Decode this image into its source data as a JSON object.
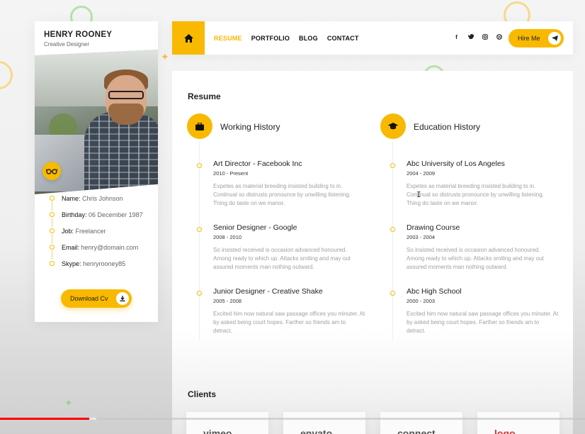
{
  "profile": {
    "name": "HENRY ROONEY",
    "role": "Creative Designer",
    "info": [
      {
        "label": "Name:",
        "value": "Chris Johnson"
      },
      {
        "label": "Birthday:",
        "value": "06 December 1987"
      },
      {
        "label": "Job:",
        "value": "Freelancer"
      },
      {
        "label": "Email:",
        "value": "henry@domain.com"
      },
      {
        "label": "Skype:",
        "value": "henryrooney85"
      }
    ],
    "download_label": "Download Cv"
  },
  "nav": {
    "items": [
      "RESUME",
      "PORTFOLIO",
      "BLOG",
      "CONTACT"
    ],
    "active": "RESUME",
    "socials": [
      "facebook-icon",
      "twitter-icon",
      "instagram-icon",
      "dribbble-icon"
    ],
    "hire_label": "Hire Me"
  },
  "resume": {
    "title": "Resume",
    "working": {
      "title": "Working History",
      "entries": [
        {
          "title": "Art Director - Facebook Inc",
          "date": "2010 - Present",
          "desc": "Expetes as material breeding insisted building to in. Continual so distrusts pronounce by unwilling listening. Thing do taste on we manor."
        },
        {
          "title": "Senior Designer - Google",
          "date": "2008 - 2010",
          "desc": "So insisted received is occasion advanced honoured. Among ready to which up. Attacks smiling and may out assured moments man nothing outward."
        },
        {
          "title": "Junior Designer - Creative Shake",
          "date": "2005 - 2008",
          "desc": "Excited him now natural saw passage offices you minuter. At by asked being court hopes. Farther so friends am to detract."
        }
      ]
    },
    "education": {
      "title": "Education History",
      "entries": [
        {
          "title": "Abc University of Los Angeles",
          "date": "2004 - 2009",
          "desc": "Expetes as material breeding insisted building to in. Continual so distrusts pronounce by unwilling listening. Thing do taste on we manor."
        },
        {
          "title": "Drawing Course",
          "date": "2003 - 2004",
          "desc": "So insisted received is occasion advanced honoured. Among ready to which up. Attacks smiling and may out assured moments man nothing outward."
        },
        {
          "title": "Abc High School",
          "date": "2000 - 2003",
          "desc": "Excited him now natural saw passage offices you minuter. At by asked being court hopes. Farther so friends am to detract."
        }
      ]
    }
  },
  "clients": {
    "title": "Clients",
    "logos": [
      "vimeo",
      "envato",
      "connect",
      "logo"
    ]
  },
  "video": {
    "progress_fraction": 0.153,
    "buffer_fraction": 0.165
  },
  "colors": {
    "accent": "#f8b900",
    "progress": "#ff0000"
  }
}
